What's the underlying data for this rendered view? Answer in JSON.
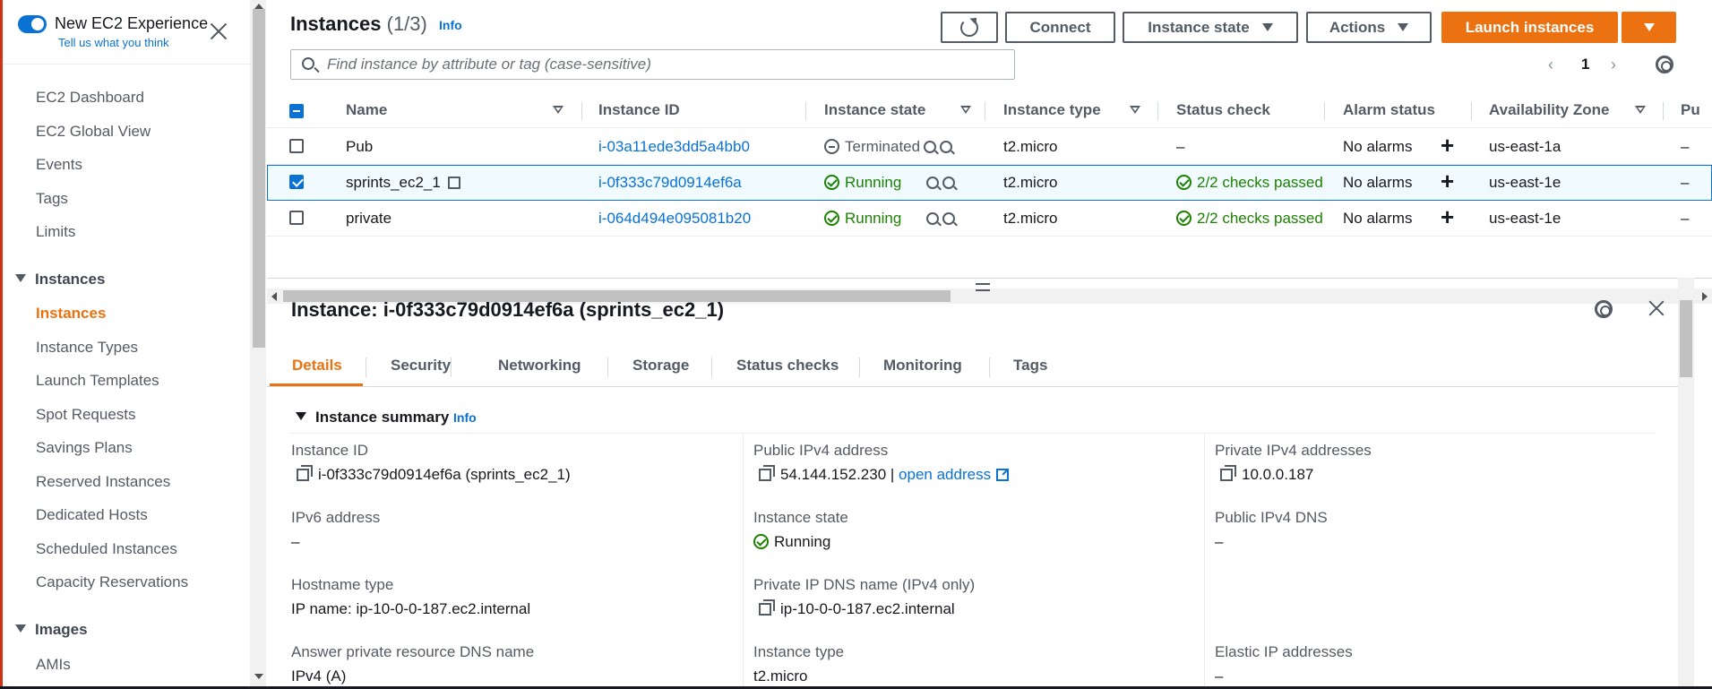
{
  "sidebar": {
    "experience_title": "New EC2 Experience",
    "experience_sub": "Tell us what you think",
    "items": [
      {
        "label": "EC2 Dashboard"
      },
      {
        "label": "EC2 Global View"
      },
      {
        "label": "Events"
      },
      {
        "label": "Tags"
      },
      {
        "label": "Limits"
      }
    ],
    "instances_section": "Instances",
    "instances_items": [
      {
        "label": "Instances"
      },
      {
        "label": "Instance Types"
      },
      {
        "label": "Launch Templates"
      },
      {
        "label": "Spot Requests"
      },
      {
        "label": "Savings Plans"
      },
      {
        "label": "Reserved Instances"
      },
      {
        "label": "Dedicated Hosts"
      },
      {
        "label": "Scheduled Instances"
      },
      {
        "label": "Capacity Reservations"
      }
    ],
    "images_section": "Images",
    "images_items": [
      {
        "label": "AMIs"
      }
    ]
  },
  "header": {
    "title": "Instances",
    "count": "(1/3)",
    "info": "Info",
    "connect": "Connect",
    "instance_state": "Instance state",
    "actions": "Actions",
    "launch": "Launch instances",
    "search_placeholder": "Find instance by attribute or tag (case-sensitive)",
    "page": "1",
    "prev": "‹",
    "next": "›"
  },
  "table": {
    "columns": [
      "Name",
      "Instance ID",
      "Instance state",
      "Instance type",
      "Status check",
      "Alarm status",
      "Availability Zone",
      "Pu"
    ],
    "rows": [
      {
        "name": "Pub",
        "id": "i-03a11ede3dd5a4bb0",
        "state": "Terminated",
        "type": "t2.micro",
        "status": "–",
        "alarm": "No alarms",
        "az": "us-east-1a",
        "pub": "–"
      },
      {
        "name": "sprints_ec2_1",
        "id": "i-0f333c79d0914ef6a",
        "state": "Running",
        "type": "t2.micro",
        "status": "2/2 checks passed",
        "alarm": "No alarms",
        "az": "us-east-1e",
        "pub": "–"
      },
      {
        "name": "private",
        "id": "i-064d494e095081b20",
        "state": "Running",
        "type": "t2.micro",
        "status": "2/2 checks passed",
        "alarm": "No alarms",
        "az": "us-east-1e",
        "pub": "–"
      }
    ]
  },
  "details": {
    "title": "Instance: i-0f333c79d0914ef6a (sprints_ec2_1)",
    "tabs": [
      "Details",
      "Security",
      "Networking",
      "Storage",
      "Status checks",
      "Monitoring",
      "Tags"
    ],
    "summary_title": "Instance summary",
    "summary_info": "Info",
    "fields": {
      "instance_id_label": "Instance ID",
      "instance_id_value": "i-0f333c79d0914ef6a (sprints_ec2_1)",
      "public_ipv4_label": "Public IPv4 address",
      "public_ipv4_value": "54.144.152.230 |",
      "open_address": "open address",
      "private_ipv4_label": "Private IPv4 addresses",
      "private_ipv4_value": "10.0.0.187",
      "ipv6_label": "IPv6 address",
      "ipv6_value": "–",
      "instance_state_label": "Instance state",
      "instance_state_value": "Running",
      "public_dns_label": "Public IPv4 DNS",
      "public_dns_value": "–",
      "hostname_type_label": "Hostname type",
      "hostname_type_value": "IP name: ip-10-0-0-187.ec2.internal",
      "private_dns_label": "Private IP DNS name (IPv4 only)",
      "private_dns_value": "ip-10-0-0-187.ec2.internal",
      "answer_dns_label": "Answer private resource DNS name",
      "answer_dns_value": "IPv4 (A)",
      "instance_type_label": "Instance type",
      "instance_type_value": "t2.micro",
      "elastic_ip_label": "Elastic IP addresses",
      "elastic_ip_value": "–"
    }
  },
  "colors": {
    "accent": "#ec7211",
    "link": "#0972d3",
    "success": "#1d8102",
    "selected_row_bg": "#f1faff"
  }
}
